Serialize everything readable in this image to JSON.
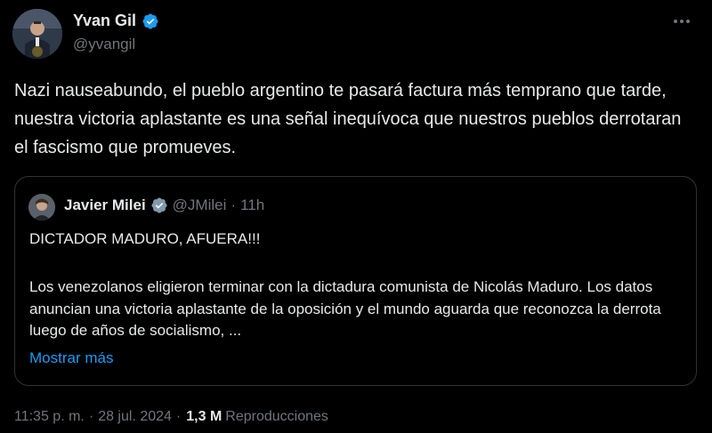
{
  "author": {
    "name": "Yvan Gil",
    "handle": "@yvangil"
  },
  "tweet_text": "Nazi nauseabundo, el pueblo argentino te pasará factura más temprano que tarde, nuestra victoria aplastante es una señal inequívoca que nuestros pueblos derrotaran el fascismo que promueves.",
  "quote": {
    "name": "Javier Milei",
    "handle": "@JMilei",
    "separator": "·",
    "time": "11h",
    "line1": "DICTADOR MADURO, AFUERA!!!",
    "body": "Los venezolanos eligieron terminar con la dictadura comunista de Nicolás Maduro. Los datos anuncian una victoria aplastante de la oposición y el mundo aguarda que reconozca la derrota luego de años de socialismo, ...",
    "show_more": "Mostrar más"
  },
  "meta": {
    "time": "11:35 p. m.",
    "separator": "·",
    "date": "28 jul. 2024",
    "views": "1,3 M",
    "views_label": "Reproducciones"
  },
  "colors": {
    "background": "#000000",
    "text": "#e7e9ea",
    "secondary": "#71767b",
    "accent": "#1d9bf0",
    "border": "#2f3336"
  },
  "icons": {
    "verified": "verified-badge-icon",
    "more": "more-horizontal-icon"
  }
}
